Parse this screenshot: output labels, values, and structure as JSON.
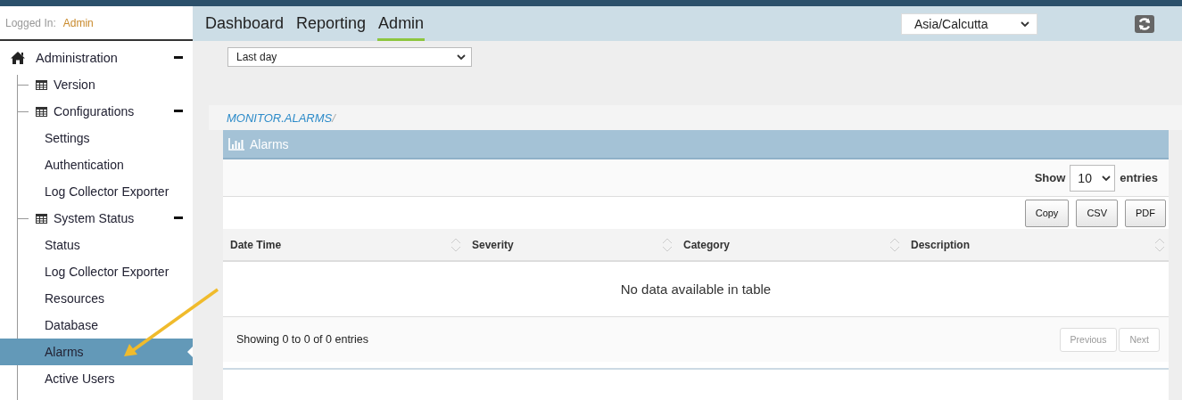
{
  "session": {
    "label": "Logged In:",
    "user": "Admin"
  },
  "sidebar": {
    "items": [
      {
        "label": "Administration",
        "expanded": true,
        "selected": false,
        "children": [
          {
            "label": "Version",
            "selected": false
          },
          {
            "label": "Configurations",
            "expanded": true,
            "selected": false,
            "children": [
              {
                "label": "Settings",
                "selected": false
              },
              {
                "label": "Authentication",
                "selected": false
              },
              {
                "label": "Log Collector Exporter",
                "selected": false
              }
            ]
          },
          {
            "label": "System Status",
            "expanded": true,
            "selected": false,
            "children": [
              {
                "label": "Status",
                "selected": false
              },
              {
                "label": "Log Collector Exporter",
                "selected": false
              },
              {
                "label": "Resources",
                "selected": false
              },
              {
                "label": "Database",
                "selected": false
              },
              {
                "label": "Alarms",
                "selected": true
              },
              {
                "label": "Active Users",
                "selected": false
              }
            ]
          }
        ]
      }
    ]
  },
  "tabs": [
    {
      "label": "Dashboard",
      "selected": false
    },
    {
      "label": "Reporting",
      "selected": false
    },
    {
      "label": "Admin",
      "selected": true
    }
  ],
  "timezone": {
    "value": "Asia/Calcutta"
  },
  "range": {
    "value": "Last day"
  },
  "breadcrumb": {
    "text": "MONITOR.ALARMS",
    "separator": "/"
  },
  "panel": {
    "title": "Alarms",
    "length": {
      "before": "Show",
      "value": "10",
      "after": "entries"
    },
    "buttons": [
      "Copy",
      "CSV",
      "PDF"
    ],
    "table": {
      "columns": [
        "Date Time",
        "Severity",
        "Category",
        "Description"
      ],
      "empty": "No data available in table"
    },
    "info": "Showing 0 to 0 of 0 entries",
    "pager": [
      {
        "label": "Previous",
        "disabled": true
      },
      {
        "label": "Next",
        "disabled": true
      }
    ]
  }
}
